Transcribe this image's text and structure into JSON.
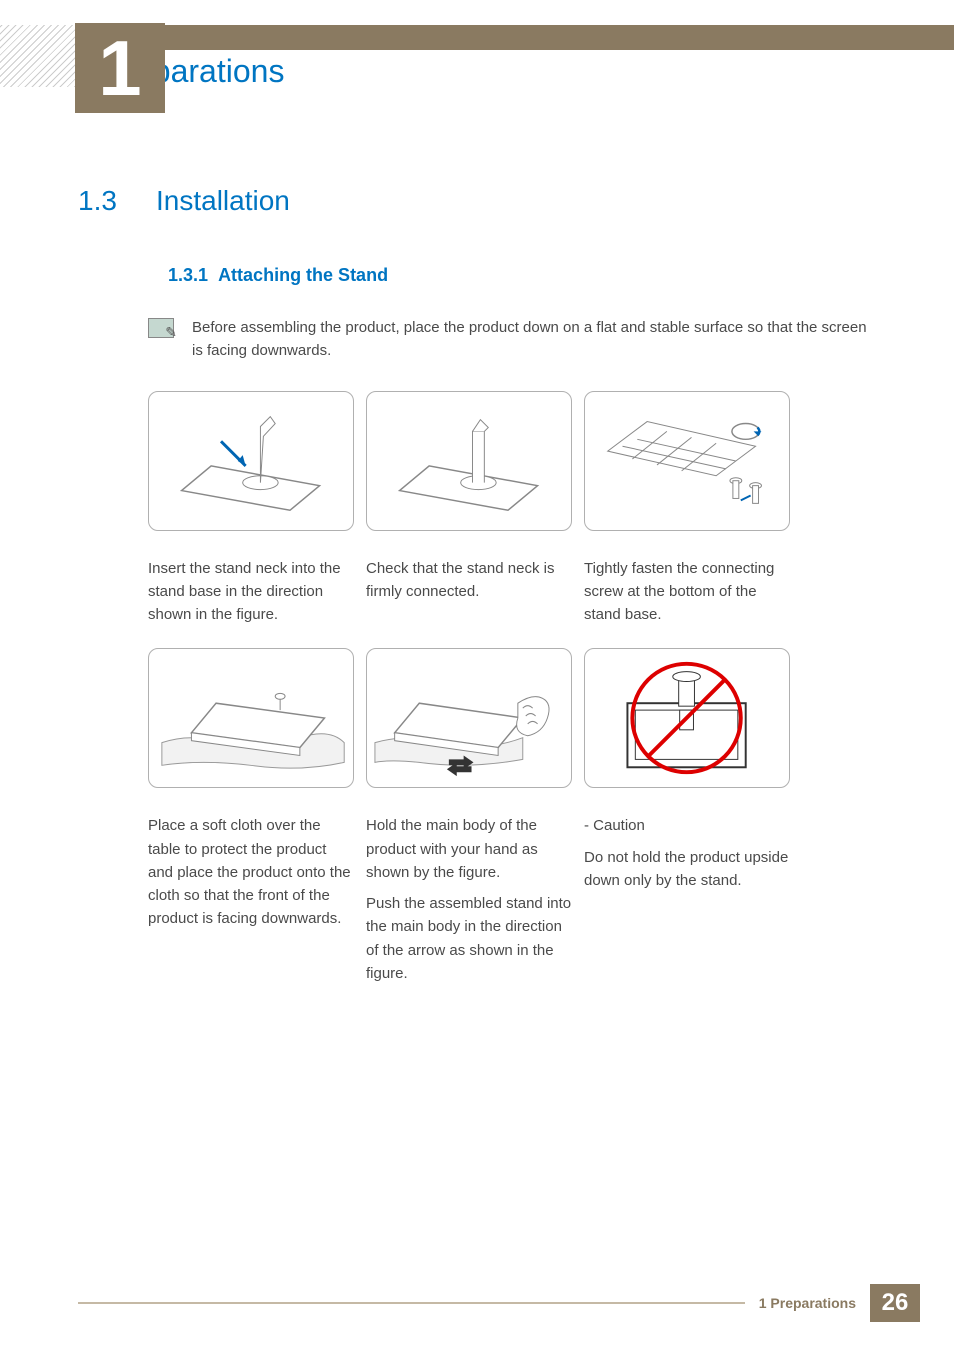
{
  "chapter": {
    "number": "1",
    "title": "Preparations"
  },
  "section": {
    "number": "1.3",
    "title": "Installation"
  },
  "subsection": {
    "number": "1.3.1",
    "title": "Attaching the Stand"
  },
  "note": "Before assembling the product, place the product down on a flat and stable surface so that the screen is facing downwards.",
  "steps": [
    {
      "caption": "Insert the stand neck into the stand base in the direction shown in the figure."
    },
    {
      "caption": "Check that the stand neck is firmly connected."
    },
    {
      "caption": "Tightly fasten the connecting screw at the bottom of the stand base."
    },
    {
      "caption": "Place a soft cloth over the table to protect the product and place the product onto the cloth so that the front of the product is facing downwards."
    },
    {
      "caption": "Hold the main body of the product with your hand as shown by the figure.",
      "caption2": "Push the assembled stand into the main body in the direction of the arrow as shown in the figure."
    },
    {
      "caption": "- Caution",
      "caption2": "Do not hold the product upside down only by the stand."
    }
  ],
  "footer": {
    "label": "1 Preparations",
    "page": "26"
  }
}
